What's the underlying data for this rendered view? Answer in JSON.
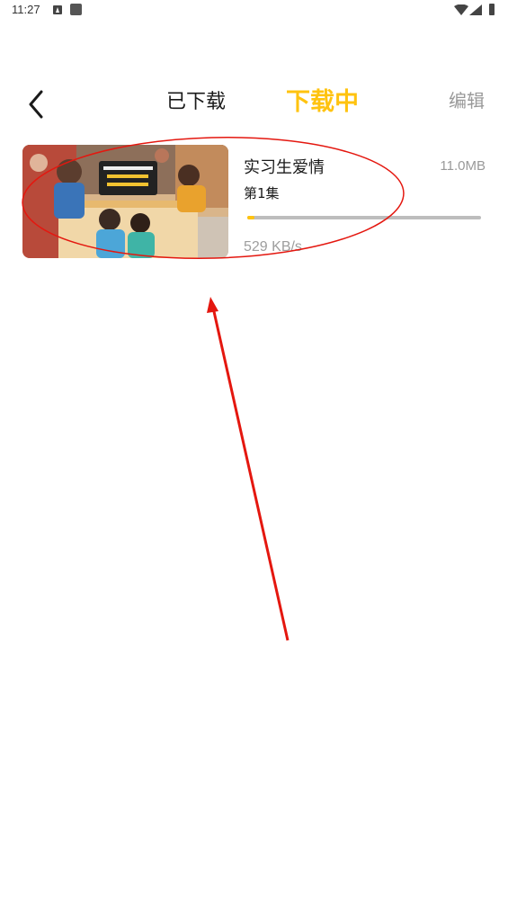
{
  "status_bar": {
    "time": "11:27"
  },
  "header": {
    "back_icon": "chevron-left-icon",
    "tabs": [
      {
        "label": "已下载",
        "active": false
      },
      {
        "label": "下载中",
        "active": true
      }
    ],
    "edit_label": "编辑"
  },
  "downloads": [
    {
      "title": "实习生爱情",
      "size": "11.0MB",
      "episode": "第1集",
      "progress": 0.03,
      "speed": "529 KB/s"
    }
  ],
  "colors": {
    "accent": "#ffc30f",
    "annotation": "#e4170f",
    "secondary_text": "#999999",
    "track": "#bdbdbd"
  }
}
